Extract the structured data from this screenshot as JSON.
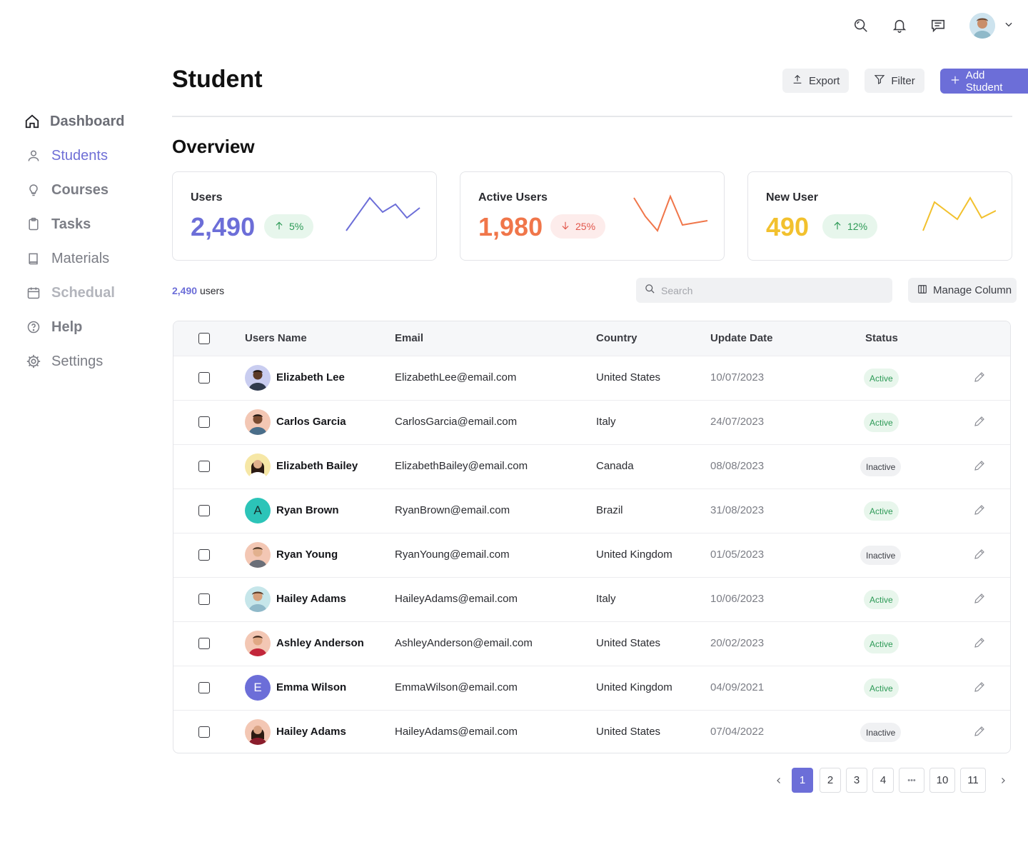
{
  "sidebar": {
    "items": [
      {
        "label": "Dashboard",
        "icon": "home-icon"
      },
      {
        "label": "Students",
        "icon": "user-icon"
      },
      {
        "label": "Courses",
        "icon": "lightbulb-icon"
      },
      {
        "label": "Tasks",
        "icon": "clipboard-icon"
      },
      {
        "label": "Materials",
        "icon": "book-icon"
      },
      {
        "label": "Schedual",
        "icon": "calendar-icon"
      },
      {
        "label": "Help",
        "icon": "help-icon"
      },
      {
        "label": "Settings",
        "icon": "gear-icon"
      }
    ]
  },
  "header": {
    "title": "Student",
    "export_label": "Export",
    "filter_label": "Filter",
    "add_label": "Add Student"
  },
  "overview": {
    "title": "Overview",
    "cards": [
      {
        "title": "Users",
        "value": "2,490",
        "change": "5%",
        "direction": "up",
        "color": "#6c6ed8"
      },
      {
        "title": "Active Users",
        "value": "1,980",
        "change": "25%",
        "direction": "down",
        "color": "#f0764a"
      },
      {
        "title": "New User",
        "value": "490",
        "change": "12%",
        "direction": "up",
        "color": "#f2c12e"
      }
    ]
  },
  "toolbar": {
    "count_number": "2,490",
    "count_suffix": "users",
    "search_placeholder": "Search",
    "manage_label": "Manage Column"
  },
  "table": {
    "headers": {
      "name": "Users Name",
      "email": "Email",
      "country": "Country",
      "date": "Update Date",
      "status": "Status"
    },
    "rows": [
      {
        "name": "Elizabeth Lee",
        "email": "ElizabethLee@email.com",
        "country": "United States",
        "date": "10/07/2023",
        "status": "Active"
      },
      {
        "name": "Carlos Garcia",
        "email": "CarlosGarcia@email.com",
        "country": "Italy",
        "date": "24/07/2023",
        "status": "Active"
      },
      {
        "name": "Elizabeth Bailey",
        "email": "ElizabethBailey@email.com",
        "country": "Canada",
        "date": "08/08/2023",
        "status": "Inactive"
      },
      {
        "name": "Ryan Brown",
        "email": "RyanBrown@email.com",
        "country": "Brazil",
        "date": "31/08/2023",
        "status": "Active",
        "initial": "A"
      },
      {
        "name": "Ryan Young",
        "email": "RyanYoung@email.com",
        "country": "United Kingdom",
        "date": "01/05/2023",
        "status": "Inactive"
      },
      {
        "name": "Hailey Adams",
        "email": "HaileyAdams@email.com",
        "country": "Italy",
        "date": "10/06/2023",
        "status": "Active"
      },
      {
        "name": "Ashley Anderson",
        "email": "AshleyAnderson@email.com",
        "country": "United States",
        "date": "20/02/2023",
        "status": "Active"
      },
      {
        "name": "Emma Wilson",
        "email": "EmmaWilson@email.com",
        "country": "United Kingdom",
        "date": "04/09/2021",
        "status": "Active",
        "initial": "E"
      },
      {
        "name": "Hailey Adams",
        "email": "HaileyAdams@email.com",
        "country": "United States",
        "date": "07/04/2022",
        "status": "Inactive"
      }
    ]
  },
  "pagination": {
    "pages": [
      "1",
      "2",
      "3",
      "4",
      "10",
      "11"
    ],
    "ellipsis": "•••",
    "current": "1"
  }
}
